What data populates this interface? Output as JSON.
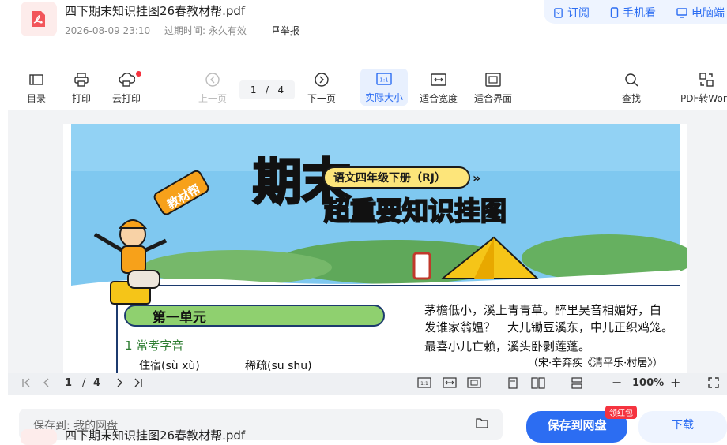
{
  "header": {
    "title": "四下期末知识挂图26春教材帮.pdf",
    "date": "2026-08-09 23:10",
    "expire_label": "过期时间:",
    "expire_value": "永久有效",
    "report_label": "举报",
    "actions": [
      "订阅",
      "手机看",
      "电脑端"
    ]
  },
  "toolbar": {
    "toc": "目录",
    "print": "打印",
    "cloud_print": "云打印",
    "prev": "上一页",
    "page_current": "1",
    "page_sep": "/",
    "page_total": "4",
    "next": "下一页",
    "actual_size": "实际大小",
    "fit_width": "适合宽度",
    "fit_page": "适合界面",
    "search": "查找",
    "pdf_to_word": "PDF转Word"
  },
  "poster": {
    "brand": "教材帮",
    "title_big": "期末",
    "title_sub": "超重要知识挂图",
    "grade": "语文四年级下册（RJ）",
    "unit": "第一单元",
    "section": "1  常考字音",
    "words": [
      "住宿(sù  xù)",
      "稀疏(sū  shū)"
    ],
    "poem_lines": [
      "茅檐低小，溪上青青草。醉里吴音相媚好，白",
      "发谁家翁媪？　大儿锄豆溪东，中儿正织鸡笼。",
      "最喜小儿亡赖，溪头卧剥莲蓬。"
    ],
    "poem_source": "（宋·辛弃疾《清平乐·村居》）"
  },
  "statusbar": {
    "page_current": "1",
    "page_sep": "/",
    "page_total": "4",
    "zoom": "100%"
  },
  "ghost": {
    "save_to": "保存到:  我的网盘",
    "save_button": "保存到网盘",
    "red_tag": "领红包",
    "download": "下载",
    "title": "四下期末知识挂图26春教材帮.pdf"
  },
  "colors": {
    "accent": "#2c6df2",
    "red": "#f5333f",
    "sky": "#7fc8f0",
    "grass": "#76b86a"
  }
}
